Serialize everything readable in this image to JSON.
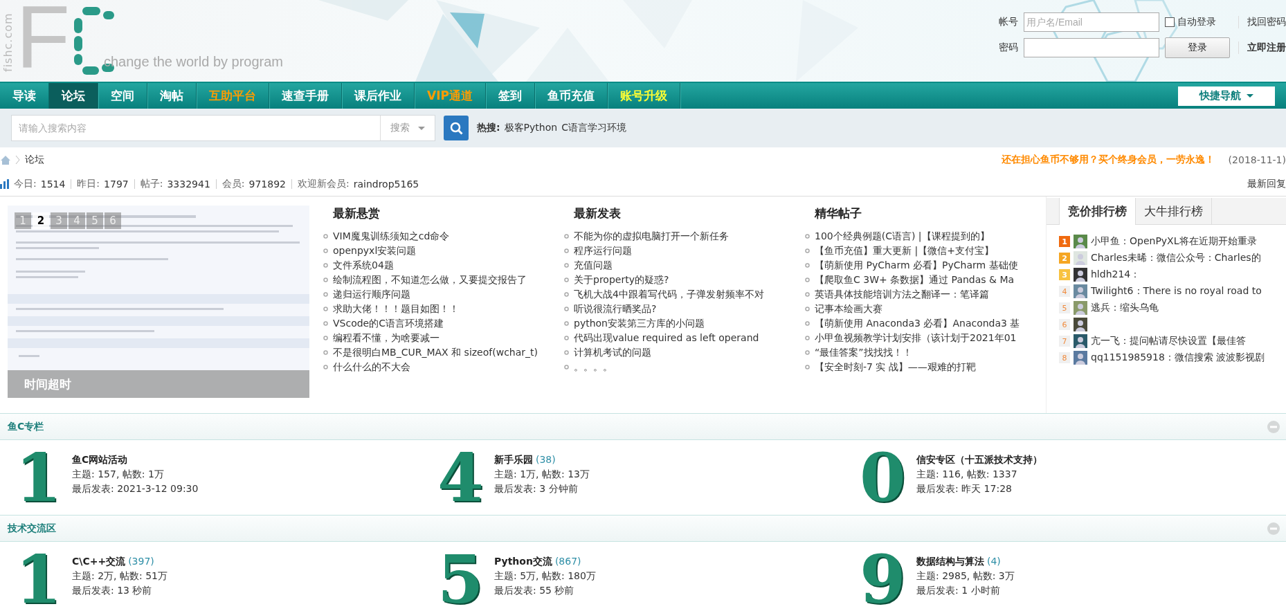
{
  "header": {
    "domain": "fishc.com",
    "logo_letter": "F",
    "tagline": "change the world by program",
    "login": {
      "account_label": "帐号",
      "account_placeholder": "用户名/Email",
      "auto_login": {
        "label": "自动登录",
        "checked": false
      },
      "password_label": "密码",
      "login_button": "登录",
      "forgot": "找回密码",
      "register": "立即注册"
    }
  },
  "nav": {
    "items": [
      {
        "label": "导读",
        "selected": false,
        "kind": "plain"
      },
      {
        "label": "论坛",
        "selected": true,
        "kind": "plain"
      },
      {
        "label": "空间",
        "selected": false,
        "kind": "plain"
      },
      {
        "label": "淘帖",
        "selected": false,
        "kind": "plain"
      },
      {
        "label": "互助平台",
        "selected": false,
        "kind": "promo"
      },
      {
        "label": "速查手册",
        "selected": false,
        "kind": "plain"
      },
      {
        "label": "课后作业",
        "selected": false,
        "kind": "plain"
      },
      {
        "label": "VIP通道",
        "selected": false,
        "kind": "promo"
      },
      {
        "label": "签到",
        "selected": false,
        "kind": "plain"
      },
      {
        "label": "鱼币充值",
        "selected": false,
        "kind": "plain"
      },
      {
        "label": "账号升级",
        "selected": false,
        "kind": "upgrade"
      }
    ],
    "quick_nav": "快捷导航"
  },
  "search": {
    "placeholder": "请输入搜索内容",
    "scope": "搜索",
    "hot_label": "热搜:",
    "hot": [
      "极客Python",
      "C语言学习环境"
    ]
  },
  "breadcrumb": {
    "current": "论坛",
    "promo": "还在担心鱼币不够用？买个终身会员，一劳永逸！",
    "date": "(2018-11-1)"
  },
  "stats": {
    "items": [
      {
        "label": "今日:",
        "value": "1514"
      },
      {
        "label": "昨日:",
        "value": "1797"
      },
      {
        "label": "帖子:",
        "value": "3332941"
      },
      {
        "label": "会员:",
        "value": "971892"
      },
      {
        "label": "欢迎新会员:",
        "value": "raindrop5165"
      }
    ],
    "latest": "最新回复"
  },
  "slider": {
    "tabs": [
      {
        "label": "1",
        "selected": false
      },
      {
        "label": "2",
        "selected": true
      },
      {
        "label": "3",
        "selected": false
      },
      {
        "label": "4",
        "selected": false
      },
      {
        "label": "5",
        "selected": false
      },
      {
        "label": "6",
        "selected": false
      }
    ],
    "caption": "时间超时"
  },
  "columns": [
    {
      "title": "最新悬赏",
      "items": [
        "VIM魔鬼训练须知之cd命令",
        "openpyxl安装问题",
        "文件系统04题",
        "绘制流程图，不知道怎么做，又要提交报告了",
        "递归运行顺序问题",
        "求助大佬！！！题目如图！！",
        "VScode的C语言环境搭建",
        "编程看不懂，为啥要减一",
        "不是很明白MB_CUR_MAX 和 sizeof(wchar_t)",
        "什么什么的不大会"
      ]
    },
    {
      "title": "最新发表",
      "items": [
        "不能为你的虚拟电脑打开一个新任务",
        "程序运行问题",
        "充值问题",
        "关于property的疑惑?",
        "飞机大战4中跟着写代码，子弹发射频率不对",
        "听说很流行晒奖品?",
        "python安装第三方库的小问题",
        "代码出现value required as left operand",
        "计算机考试的问题",
        "。。。。"
      ]
    },
    {
      "title": "精华帖子",
      "items": [
        "100个经典例题(C语言) |【课程提到的】",
        "【鱼币充值】重大更新 |【微信+支付宝】",
        "【萌新使用 PyCharm 必看】PyCharm 基础使",
        "【爬取鱼C 3W+ 条数据】通过 Pandas & Ma",
        "英语具体技能培训方法之翻译一：笔译篇",
        "记事本绘画大赛",
        "【萌新使用 Anaconda3 必看】Anaconda3 基",
        "小甲鱼视频教学计划安排（该计划于2021年01",
        "“最佳答案”找找找！！",
        "【安全时刻-7 实 战】——艰难的打靶"
      ]
    }
  ],
  "ranking": {
    "tabs": [
      {
        "label": "竞价排行榜",
        "selected": true
      },
      {
        "label": "大牛排行榜",
        "selected": false
      }
    ],
    "items": [
      {
        "rank": "1",
        "kind": "top",
        "color": "#f06a0f",
        "text": "小甲鱼：OpenPyXL将在近期开始重录"
      },
      {
        "rank": "2",
        "kind": "top",
        "color": "#f5a623",
        "text": "Charles未晞：微信公众号：Charles的"
      },
      {
        "rank": "3",
        "kind": "top",
        "color": "#f8c240",
        "text": "hldh214："
      },
      {
        "rank": "4",
        "kind": "normal",
        "color": "#f0f0f0",
        "text": "Twilight6：There is no royal road to"
      },
      {
        "rank": "5",
        "kind": "normal",
        "color": "#f0f0f0",
        "text": "逃兵：缩头乌龟"
      },
      {
        "rank": "6",
        "kind": "normal",
        "color": "#f0f0f0"
      },
      {
        "rank": "7",
        "kind": "normal",
        "color": "#f0f0f0",
        "text": "亢一飞：提问帖请尽快设置【最佳答"
      },
      {
        "rank": "8",
        "kind": "normal",
        "color": "#f0f0f0",
        "text": "qq1151985918：微信搜索 波波影视剧"
      }
    ]
  },
  "sections": [
    {
      "title": "鱼C专栏",
      "expanded": true,
      "forums": [
        {
          "badge": "1",
          "name": "鱼C网站活动",
          "stats": "主题: 157, 帖数: 1万",
          "last": "最后发表: 2021-3-12 09:30"
        },
        {
          "badge": "4",
          "name": "新手乐园",
          "count": "(38)",
          "stats": "主题: 1万, 帖数: 13万",
          "last": "最后发表: 3 分钟前"
        },
        {
          "badge": "0",
          "name": "信安专区（十五派技术支持）",
          "stats": "主题: 116, 帖数: 1337",
          "last": "最后发表: 昨天 17:28"
        }
      ]
    },
    {
      "title": "技术交流区",
      "expanded": true,
      "forums": [
        {
          "badge": "1",
          "name": "C\\C++交流",
          "count": "(397)",
          "stats": "主题: 2万, 帖数: 51万",
          "last": "最后发表: 13 秒前"
        },
        {
          "badge": "5",
          "name": "Python交流",
          "count": "(867)",
          "stats": "主题: 5万, 帖数: 180万",
          "last": "最后发表: 55 秒前"
        },
        {
          "badge": "9",
          "name": "数据结构与算法",
          "count": "(4)",
          "stats": "主题: 2985, 帖数: 3万",
          "last": "最后发表: 1 小时前"
        }
      ]
    }
  ]
}
